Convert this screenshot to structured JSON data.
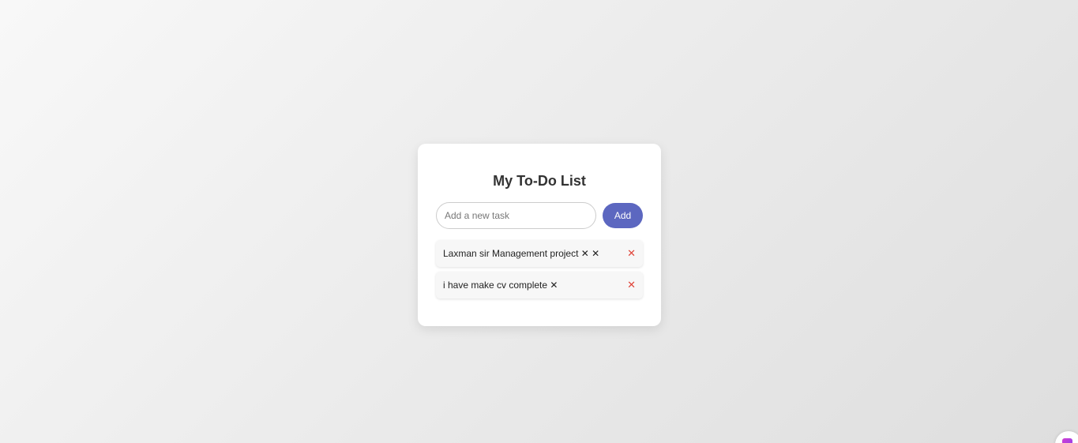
{
  "app": {
    "title": "My To-Do List"
  },
  "input": {
    "placeholder": "Add a new task",
    "value": ""
  },
  "add_button": {
    "label": "Add"
  },
  "tasks": [
    {
      "text": "Laxman sir Management project ✕ ✕",
      "delete_label": "✕"
    },
    {
      "text": "i have make cv complete ✕",
      "delete_label": "✕"
    }
  ],
  "colors": {
    "accent": "#5c67c0",
    "delete": "#e0453a",
    "card_background": "#ffffff"
  },
  "icons": {
    "delete": "close-icon",
    "corner_widget": "app-widget-icon"
  }
}
